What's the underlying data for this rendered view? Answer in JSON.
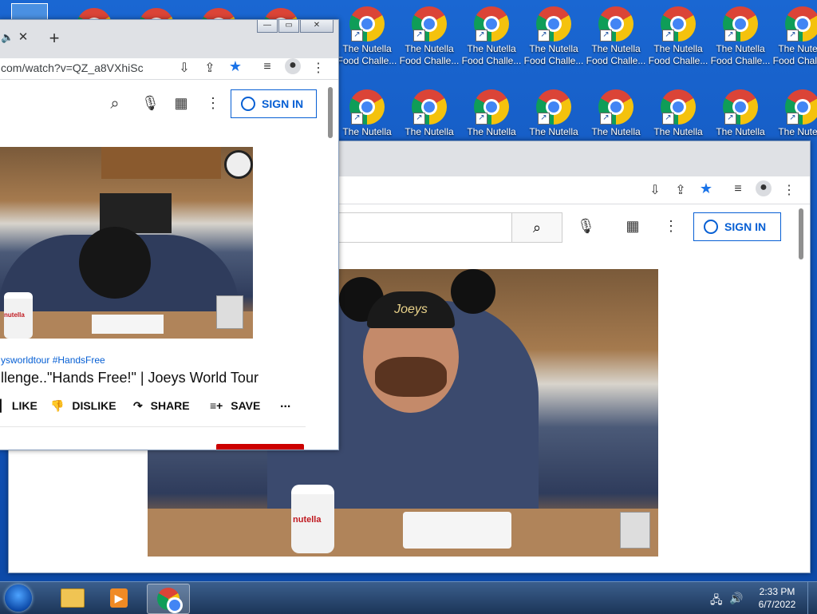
{
  "desktop": {
    "icons_row1": [
      {
        "label": "The Nutella Food Challe..."
      },
      {
        "label": "The Nutella Food Challe..."
      },
      {
        "label": "The Nutella Food Challe..."
      },
      {
        "label": "The Nutella Food Challe..."
      },
      {
        "label": "The Nutella Food Challe..."
      },
      {
        "label": "The Nutella Food Challe..."
      },
      {
        "label": "The Nutella Food Challe..."
      },
      {
        "label": "The Nutella Food Challe..."
      }
    ],
    "icons_row2": [
      {
        "label": "The Nutella"
      },
      {
        "label": "The Nutella"
      },
      {
        "label": "The Nutella"
      },
      {
        "label": "The Nutella"
      },
      {
        "label": "The Nutella"
      },
      {
        "label": "The Nutella"
      },
      {
        "label": "The Nutella"
      },
      {
        "label": "The Nutella"
      }
    ],
    "icon_row1_label1": "The Nutella",
    "icon_row1_label2": "Food Challe..."
  },
  "window_front": {
    "tab_icons": [
      "speaker-icon",
      "close-icon"
    ],
    "new_tab_glyph": "+",
    "url": "com/watch?v=QZ_a8VXhiSc",
    "signin_label": "SIGN IN",
    "hashtags": "ysworldtour #HandsFree",
    "video_title": "llenge..\"Hands Free!\" | Joeys World Tour",
    "like_label": "LIKE",
    "dislike_label": "DISLIKE",
    "share_label": "SHARE",
    "save_label": "SAVE",
    "more_glyph": "..."
  },
  "window_back": {
    "signin_label": "SIGN IN"
  },
  "video_overlay": {
    "jar_label": "nutella",
    "cap_text": "Joeys"
  },
  "taskbar": {
    "time": "2:33 PM",
    "date": "6/7/2022"
  },
  "colors": {
    "youtube_blue": "#065fd4",
    "desktop_blue": "#1560c8",
    "taskbar": "#1c3558"
  }
}
